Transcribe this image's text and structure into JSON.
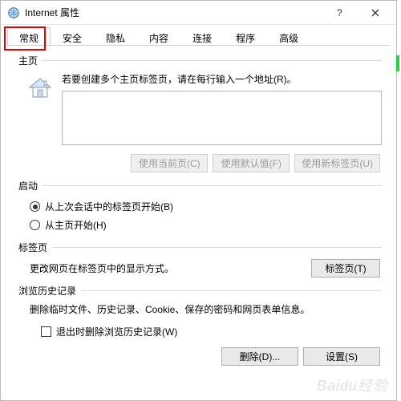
{
  "titlebar": {
    "title": "Internet 属性"
  },
  "tabs": {
    "items": [
      {
        "label": "常规"
      },
      {
        "label": "安全"
      },
      {
        "label": "隐私"
      },
      {
        "label": "内容"
      },
      {
        "label": "连接"
      },
      {
        "label": "程序"
      },
      {
        "label": "高级"
      }
    ]
  },
  "home": {
    "group_label": "主页",
    "description": "若要创建多个主页标签页，请在每行输入一个地址(R)。",
    "textarea_value": "",
    "btn_current": "使用当前页(C)",
    "btn_default": "使用默认值(F)",
    "btn_newtab": "使用新标签页(U)"
  },
  "startup": {
    "group_label": "启动",
    "opt_last_session": "从上次会话中的标签页开始(B)",
    "opt_home": "从主页开始(H)"
  },
  "tabs_group": {
    "group_label": "标签页",
    "description": "更改网页在标签页中的显示方式。",
    "btn": "标签页(T)"
  },
  "history": {
    "group_label": "浏览历史记录",
    "description": "删除临时文件、历史记录、Cookie、保存的密码和网页表单信息。",
    "chk_delete_on_exit": "退出时删除浏览历史记录(W)",
    "btn_delete": "删除(D)...",
    "btn_settings": "设置(S)"
  },
  "watermark": "Baidu经验"
}
